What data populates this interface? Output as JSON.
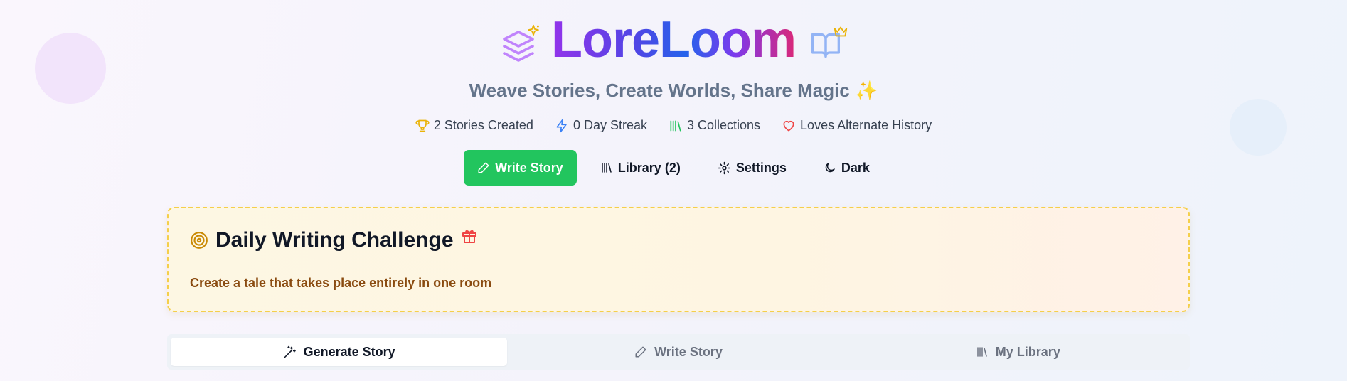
{
  "brand": {
    "title": "LoreLoom",
    "subtitle": "Weave Stories, Create Worlds, Share Magic ✨"
  },
  "stats": [
    {
      "icon": "trophy-icon",
      "label": "2 Stories Created"
    },
    {
      "icon": "lightning-icon",
      "label": "0 Day Streak"
    },
    {
      "icon": "library-icon",
      "label": "3 Collections"
    },
    {
      "icon": "heart-icon",
      "label": "Loves Alternate History"
    }
  ],
  "nav": {
    "write_story": "Write Story",
    "library": "Library (2)",
    "settings": "Settings",
    "dark": "Dark"
  },
  "challenge": {
    "title": "Daily Writing Challenge",
    "prompt": "Create a tale that takes place entirely in one room"
  },
  "tabs": [
    {
      "label": "Generate Story",
      "active": true
    },
    {
      "label": "Write Story",
      "active": false
    },
    {
      "label": "My Library",
      "active": false
    }
  ],
  "colors": {
    "primary_button": "#22c55e",
    "challenge_border": "#f5cf4a",
    "challenge_text": "#8a4b10",
    "trophy": "#eab308",
    "lightning": "#3b82f6",
    "library": "#22c55e",
    "heart": "#ef4444"
  }
}
